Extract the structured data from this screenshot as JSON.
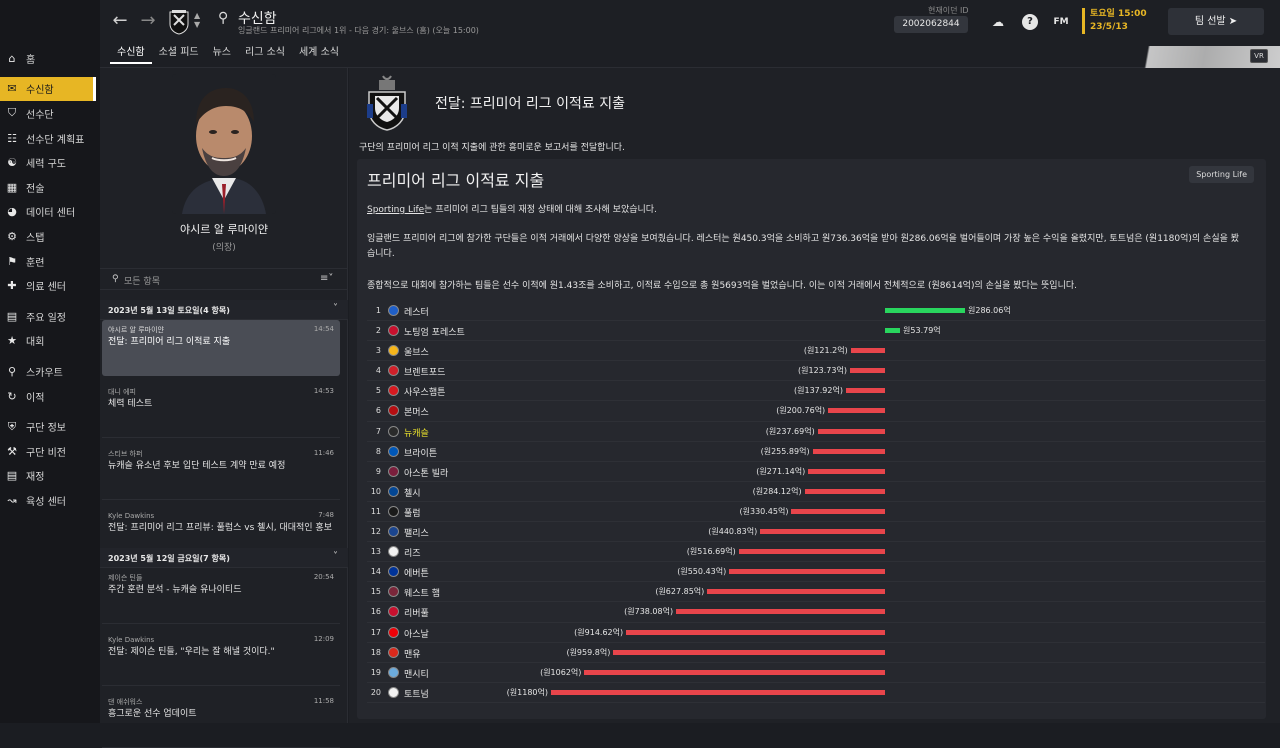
{
  "app": {
    "game_logo": "FM"
  },
  "sidebar": {
    "groups": [
      [
        {
          "label": "홈",
          "icon": "home-icon"
        }
      ],
      [
        {
          "label": "수신함",
          "icon": "inbox-icon",
          "active": true
        },
        {
          "label": "선수단",
          "icon": "shirt-icon"
        },
        {
          "label": "선수단 계획표",
          "icon": "clipboard-icon"
        },
        {
          "label": "세력 구도",
          "icon": "dynamics-icon"
        },
        {
          "label": "전술",
          "icon": "tactics-icon"
        },
        {
          "label": "데이터 센터",
          "icon": "data-icon"
        },
        {
          "label": "스탭",
          "icon": "staff-icon"
        },
        {
          "label": "훈련",
          "icon": "training-icon"
        },
        {
          "label": "의료 센터",
          "icon": "medical-icon"
        }
      ],
      [
        {
          "label": "주요 일정",
          "icon": "calendar-icon"
        },
        {
          "label": "대회",
          "icon": "trophy-icon"
        }
      ],
      [
        {
          "label": "스카우트",
          "icon": "scout-icon"
        },
        {
          "label": "이적",
          "icon": "transfer-icon"
        }
      ],
      [
        {
          "label": "구단 정보",
          "icon": "club-info-icon"
        },
        {
          "label": "구단 비전",
          "icon": "vision-icon"
        },
        {
          "label": "재정",
          "icon": "finance-icon"
        },
        {
          "label": "육성 센터",
          "icon": "development-icon"
        }
      ]
    ]
  },
  "header": {
    "title": "수신함",
    "subtitle": "잉글랜드 프리미어 리그에서 1위 - 다음 경기: 울브스 (홈) (오늘 15:00)",
    "tabs": [
      "수신함",
      "소셜 피드",
      "뉴스",
      "리그 소식",
      "세계 소식"
    ],
    "manager_id_label": "현재이던 ID",
    "manager_id": "2002062844",
    "date_day": "토요일 15:00",
    "date": "23/5/13",
    "continue_label": "팀 선발",
    "vr_label": "VR"
  },
  "left": {
    "person_name": "야시르 알 루마이얀",
    "person_role": "(의장)",
    "search_placeholder": "모든 항목",
    "group1": "2023년 5월 13일 토요일(4 항목)",
    "group2": "2023년 5월 12일 금요일(7 항목)",
    "messages1": [
      {
        "sender": "야시르 알 루마이얀",
        "time": "14:54",
        "subject": "전달: 프리미어 리그 이적료 지출",
        "selected": true
      },
      {
        "sender": "대니 에피",
        "time": "14:53",
        "subject": "체력 테스트"
      },
      {
        "sender": "스티브 하퍼",
        "time": "11:46",
        "subject": "뉴캐슬 유소년 후보 입단 테스트 계약 만료 예정"
      },
      {
        "sender": "Kyle Dawkins",
        "time": "7:48",
        "subject": "전달: 프리미어 리그 프리뷰: 풀럼스 vs 첼시, 대대적인 홍보"
      }
    ],
    "messages2": [
      {
        "sender": "제이슨 틴들",
        "time": "20:54",
        "subject": "주간 훈련 분석 - 뉴캐슬 유나이티드"
      },
      {
        "sender": "Kyle Dawkins",
        "time": "12:09",
        "subject": "전달: 제이슨 틴들, \"우리는 잘 해낼 것이다.\""
      },
      {
        "sender": "댄 애쉬워스",
        "time": "11:58",
        "subject": "흥그로운 선수 업데이트"
      }
    ]
  },
  "content": {
    "title": "전달: 프리미어 리그 이적료 지출",
    "intro": "구단의 프리미어 리그 이적 지출에 관한 흥미로운 보고서를 전달합니다.",
    "card_title": "프리미어 리그 이적료 지출",
    "source": "Sporting Life",
    "para1_link": "Sporting Life",
    "para1_rest": "는 프리미어 리그 팀들의 재정 상태에 대해 조사해 보았습니다.",
    "para2": "잉글랜드 프리미어 리그에 참가한 구단들은 이적 거래에서 다양한 양상을 보여줬습니다. 레스터는 원450.3억을 소비하고 원736.36억을 받아 원286.06억을 벌어들이며 가장 높은 수익을 올렸지만, 토트넘은 (원1180억)의 손실을 봤습니다.",
    "para3": "종합적으로 대회에 참가하는 팀들은 선수 이적에 원1.43조를 소비하고, 이적료 수입으로 총 원5693억을 벌었습니다. 이는 이적 거래에서 전체적으로 (원8614억)의 손실을 봤다는 뜻입니다."
  },
  "chart_data": {
    "type": "bar",
    "title": "프리미어 리그 이적료 지출",
    "unit": "억 원",
    "ranks": [
      "1",
      "2",
      "3",
      "4",
      "5",
      "6",
      "7",
      "8",
      "9",
      "10",
      "11",
      "12",
      "13",
      "14",
      "15",
      "16",
      "17",
      "18",
      "19",
      "20"
    ],
    "categories": [
      "레스터",
      "노팅엄 포레스트",
      "울브스",
      "브렌트포드",
      "사우스햄튼",
      "본머스",
      "뉴캐슬",
      "브라이튼",
      "아스톤 빌라",
      "첼시",
      "풀럼",
      "팰리스",
      "리즈",
      "에버튼",
      "웨스트 햄",
      "리버풀",
      "아스날",
      "맨유",
      "맨시티",
      "토트넘"
    ],
    "values": [
      286.06,
      53.79,
      -121.2,
      -123.73,
      -137.92,
      -200.76,
      -237.69,
      -255.89,
      -271.14,
      -284.12,
      -330.45,
      -440.83,
      -516.69,
      -550.43,
      -627.85,
      -738.08,
      -914.62,
      -959.8,
      -1062,
      -1180
    ],
    "labels": [
      "원286.06억",
      "원53.79억",
      "(원121.2억)",
      "(원123.73억)",
      "(원137.92억)",
      "(원200.76억)",
      "(원237.69억)",
      "(원255.89억)",
      "(원271.14억)",
      "(원284.12억)",
      "(원330.45억)",
      "(원440.83억)",
      "(원516.69억)",
      "(원550.43억)",
      "(원627.85억)",
      "(원738.08억)",
      "(원914.62억)",
      "(원959.8억)",
      "(원1062억)",
      "(원1180억)"
    ],
    "highlight": "뉴캐슬",
    "positive_color": "#29d65e",
    "negative_color": "#e8454b",
    "crest_colors": [
      "#1f5fc8",
      "#c8102e",
      "#f6b51a",
      "#d0202a",
      "#d71920",
      "#b50e12",
      "#2a2a2a",
      "#0057b8",
      "#7a1e3c",
      "#034694",
      "#1a1a1a",
      "#1b458f",
      "#f2f2f2",
      "#003399",
      "#7a263a",
      "#c8102e",
      "#ef0107",
      "#da291c",
      "#6cabdd",
      "#f2f2f2"
    ]
  }
}
